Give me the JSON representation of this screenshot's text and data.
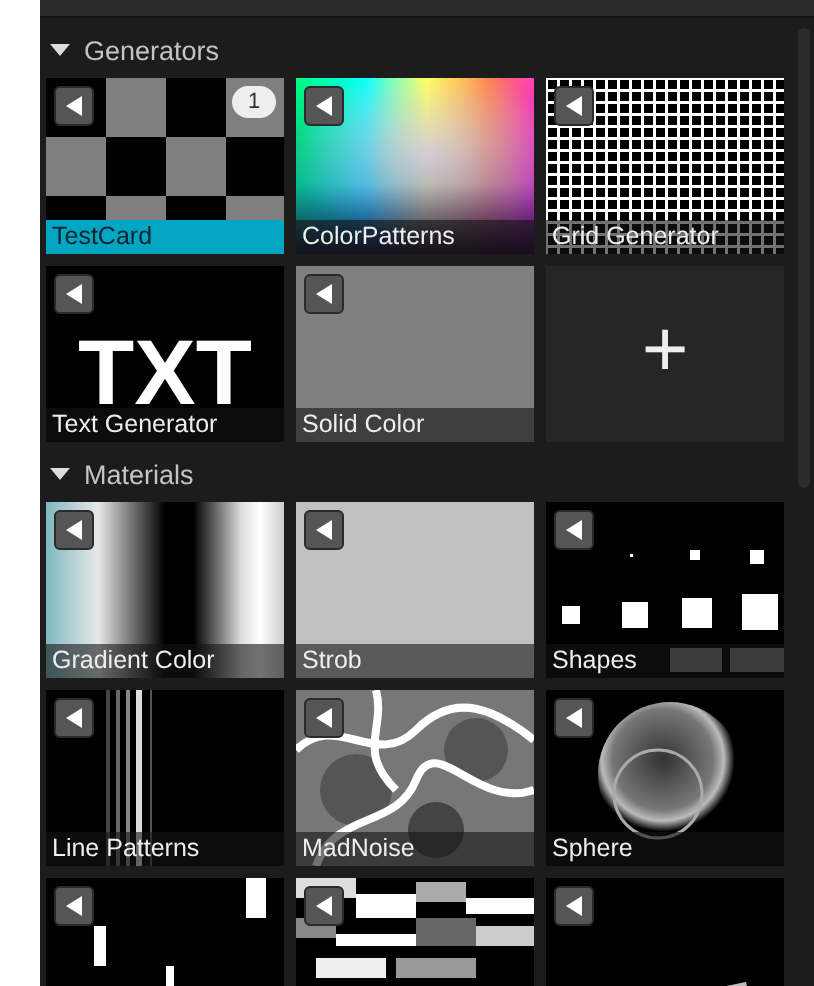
{
  "sections": [
    {
      "title": "Generators",
      "expanded": true,
      "tiles": [
        {
          "kind": "checker",
          "label": "TestCard",
          "selected": true,
          "badge": "1"
        },
        {
          "kind": "spectrum",
          "label": "ColorPatterns",
          "selected": false
        },
        {
          "kind": "grid",
          "label": "Grid Generator",
          "selected": false
        },
        {
          "kind": "text",
          "label": "Text Generator",
          "selected": false,
          "text": "TXT"
        },
        {
          "kind": "solid",
          "label": "Solid Color",
          "selected": false
        },
        {
          "kind": "add",
          "text": "+"
        }
      ]
    },
    {
      "title": "Materials",
      "expanded": true,
      "tiles": [
        {
          "kind": "gradient",
          "label": "Gradient Color",
          "selected": false
        },
        {
          "kind": "strobe",
          "label": "Strob",
          "selected": false
        },
        {
          "kind": "shapes",
          "label": "Shapes",
          "selected": false
        },
        {
          "kind": "lines",
          "label": "Line Patterns",
          "selected": false
        },
        {
          "kind": "noise",
          "label": "MadNoise",
          "selected": false
        },
        {
          "kind": "sphere",
          "label": "Sphere",
          "selected": false
        },
        {
          "kind": "blocks"
        },
        {
          "kind": "mosaic"
        },
        {
          "kind": "dark"
        }
      ]
    }
  ]
}
